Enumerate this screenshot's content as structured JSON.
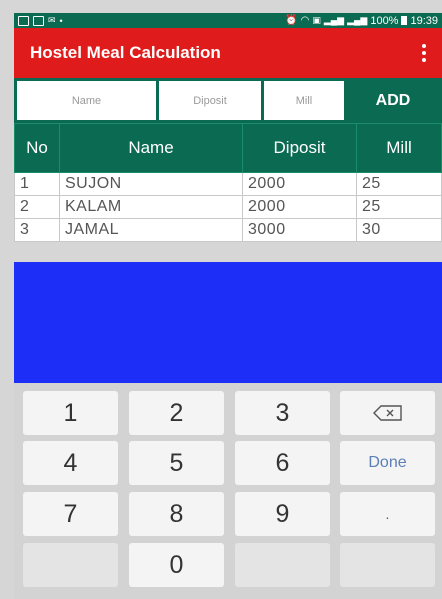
{
  "status_bar": {
    "left_icons": [
      "image-icon",
      "photo-icon",
      "mail-icon",
      "dot-icon"
    ],
    "right_icons": [
      "alarm-icon",
      "wifi-icon",
      "sim-icon",
      "signal-icon",
      "signal-icon-2"
    ],
    "battery": "100%",
    "time": "19:39",
    "color": "#0b6a52"
  },
  "app_bar": {
    "title": "Hostel Meal Calculation",
    "color": "#e01b1b",
    "menu_icon": "overflow-menu-icon"
  },
  "form": {
    "name_placeholder": "Name",
    "deposit_placeholder": "Diposit",
    "mill_placeholder": "Mill",
    "add_label": "ADD"
  },
  "table": {
    "headers": [
      "No",
      "Name",
      "Diposit",
      "Mill"
    ],
    "rows": [
      [
        "1",
        "SUJON",
        "2000",
        "25"
      ],
      [
        "2",
        "KALAM",
        "2000",
        "25"
      ],
      [
        "3",
        "JAMAL",
        "3000",
        "30"
      ]
    ]
  },
  "keyboard": {
    "keys": [
      "1",
      "2",
      "3",
      "backspace-icon",
      "4",
      "5",
      "6",
      "Done",
      "7",
      "8",
      "9",
      ".",
      "",
      "0",
      "",
      ""
    ],
    "done_label": "Done",
    "dot_label": "."
  },
  "colors": {
    "header_green": "#0b6a52",
    "app_red": "#e01b1b",
    "blue_area": "#1d2ff6",
    "done_blue": "#5b7fb6"
  }
}
